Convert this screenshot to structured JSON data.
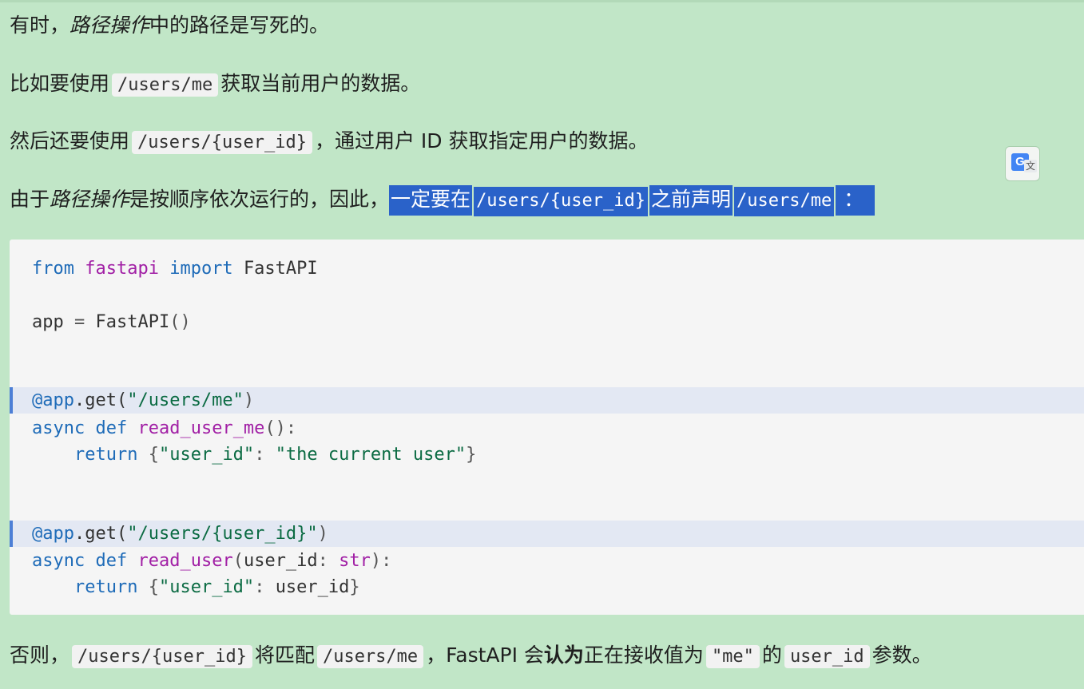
{
  "para1": {
    "pre": "有时，",
    "em": "路径操作",
    "post": "中的路径是写死的。"
  },
  "para2": {
    "pre": "比如要使用",
    "code": "/users/me",
    "post": "获取当前用户的数据。"
  },
  "para3": {
    "pre": "然后还要使用",
    "code": "/users/{user_id}",
    "post": "，通过用户 ID 获取指定用户的数据。"
  },
  "para4": {
    "pre": "由于",
    "em": "路径操作",
    "mid": "是按顺序依次运行的，因此，",
    "hl1": "一定要在",
    "hl_code1": "/users/{user_id}",
    "hl2": "之前声明",
    "hl_code2": "/users/me",
    "hl3": "："
  },
  "translate_button": {
    "g": "G",
    "wen": "文"
  },
  "code": {
    "l1_kw1": "from",
    "l1_mod": "fastapi",
    "l1_kw2": "import",
    "l1_name": "FastAPI",
    "l2_a": "app",
    "l2_eq": " = ",
    "l2_cls": "FastAPI",
    "l2_paren": "()",
    "l3_dec": "@app",
    "l3_get": ".get(",
    "l3_str": "\"/users/me\"",
    "l3_close": ")",
    "l4_async": "async",
    "l4_def": "def",
    "l4_fn": "read_user_me",
    "l4_tail": "():",
    "l5_return": "return",
    "l5_open": "{",
    "l5_key": "\"user_id\"",
    "l5_colon": ": ",
    "l5_val": "\"the current user\"",
    "l5_close": "}",
    "l6_dec": "@app",
    "l6_get": ".get(",
    "l6_str": "\"/users/{user_id}\"",
    "l6_close": ")",
    "l7_async": "async",
    "l7_def": "def",
    "l7_fn": "read_user",
    "l7_open": "(",
    "l7_param": "user_id",
    "l7_colon": ": ",
    "l7_type": "str",
    "l7_tail": "):",
    "l8_return": "return",
    "l8_open": "{",
    "l8_key": "\"user_id\"",
    "l8_colon": ": ",
    "l8_val": "user_id",
    "l8_close": "}"
  },
  "para5": {
    "pre": "否则，",
    "code1": "/users/{user_id}",
    "mid1": "将匹配",
    "code2": "/users/me",
    "mid2": "，FastAPI 会",
    "strong": "认为",
    "mid3": "正在接收值为",
    "code3": "\"me\"",
    "mid4": "的",
    "code4": "user_id",
    "post": "参数。"
  }
}
